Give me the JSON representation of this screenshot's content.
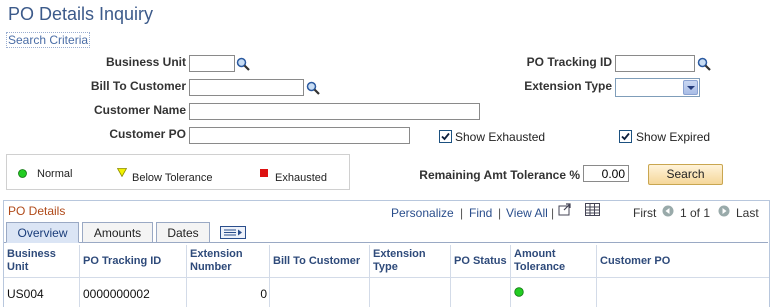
{
  "page": {
    "title": "PO Details Inquiry",
    "search_criteria_link": "Search Criteria"
  },
  "form": {
    "business_unit": {
      "label": "Business Unit",
      "value": ""
    },
    "bill_to_customer": {
      "label": "Bill To Customer",
      "value": ""
    },
    "customer_name": {
      "label": "Customer Name",
      "value": ""
    },
    "customer_po": {
      "label": "Customer PO",
      "value": ""
    },
    "po_tracking_id": {
      "label": "PO Tracking ID",
      "value": ""
    },
    "extension_type": {
      "label": "Extension Type",
      "value": ""
    },
    "show_exhausted": {
      "label": "Show Exhausted",
      "checked": true
    },
    "show_expired": {
      "label": "Show Expired",
      "checked": true
    },
    "remaining_amt_tolerance": {
      "label": "Remaining Amt Tolerance %",
      "value": "0.00"
    },
    "search_button": "Search"
  },
  "legend": {
    "normal": {
      "label": "Normal",
      "color": "#22cc22"
    },
    "below_tolerance": {
      "label": "Below Tolerance",
      "color": "#f2f200"
    },
    "exhausted": {
      "label": "Exhausted",
      "color": "#dd1111"
    }
  },
  "grid": {
    "title": "PO Details",
    "nav": {
      "personalize": "Personalize",
      "sep1": "|",
      "find": "Find",
      "sep2": "|",
      "view_all": "View All",
      "sep3": "|",
      "first": "First",
      "range": "1 of 1",
      "last": "Last"
    },
    "tabs": [
      {
        "label": "Overview",
        "active": true
      },
      {
        "label": "Amounts",
        "active": false
      },
      {
        "label": "Dates",
        "active": false
      }
    ],
    "columns": [
      [
        "Business",
        "Unit"
      ],
      [
        "PO Tracking ID"
      ],
      [
        "Extension",
        "Number"
      ],
      [
        "Bill To Customer"
      ],
      [
        "Extension",
        "Type"
      ],
      [
        "PO Status"
      ],
      [
        "Amount",
        "Tolerance"
      ],
      [
        "Customer PO"
      ]
    ],
    "rows": [
      {
        "business_unit": "US004",
        "po_tracking_id": "0000000002",
        "extension_number": "0",
        "bill_to_customer": "",
        "extension_type": "",
        "po_status": "",
        "amount_tolerance_status": "normal",
        "customer_po": ""
      }
    ]
  }
}
